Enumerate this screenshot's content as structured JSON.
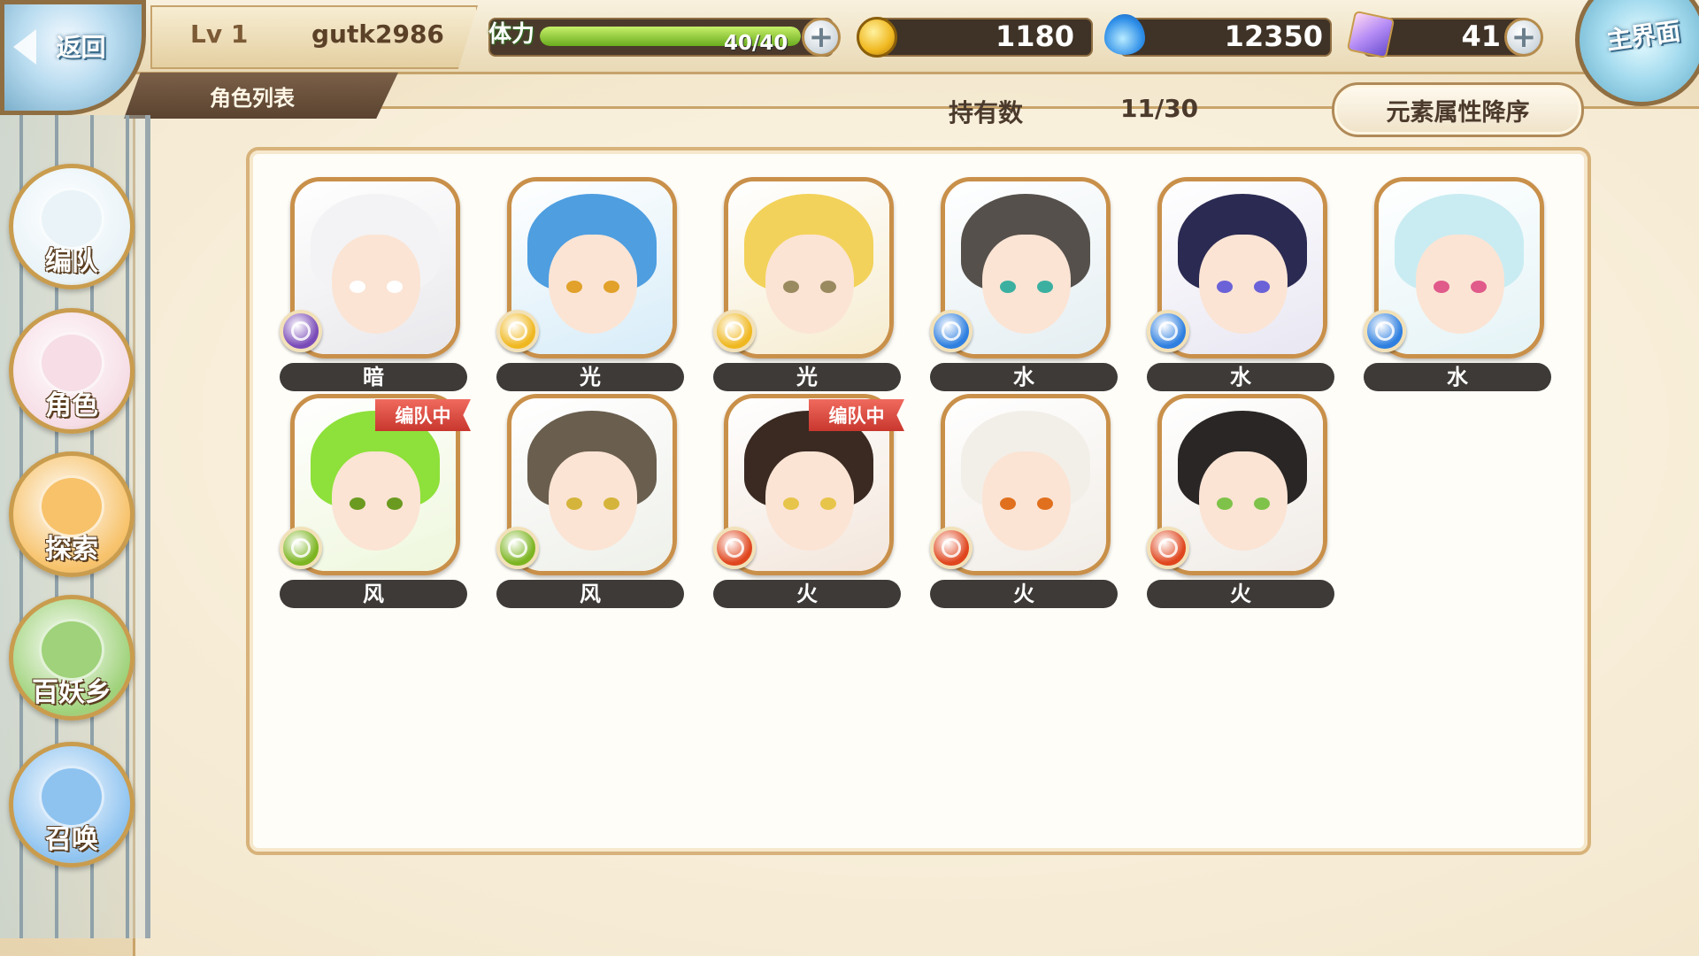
{
  "header": {
    "back_label": "返回",
    "level": "Lv 1",
    "username": "gutk2986",
    "section_title": "角色列表",
    "main_menu_label": "主界面"
  },
  "stamina": {
    "label": "体力",
    "value": "40/40",
    "fill_fraction": 1.0
  },
  "currencies": {
    "gold": {
      "icon": "gold-coin-icon",
      "value": "1180"
    },
    "soul": {
      "icon": "blue-flame-icon",
      "value": "12350"
    },
    "gem": {
      "icon": "crystal-gem-icon",
      "value": "41"
    }
  },
  "owned": {
    "label": "持有数",
    "value": "11/30"
  },
  "sort": {
    "label": "元素属性降序"
  },
  "nav": [
    {
      "id": "team",
      "label": "编队",
      "icon": "cat-mascot-icon",
      "color": "#e9f3f8"
    },
    {
      "id": "character",
      "label": "角色",
      "icon": "character-portrait-icon",
      "color": "#f6dde6"
    },
    {
      "id": "explore",
      "label": "探索",
      "icon": "compass-icon",
      "color": "#f7c26a"
    },
    {
      "id": "village",
      "label": "百妖乡",
      "icon": "village-tent-icon",
      "color": "#9fd27a"
    },
    {
      "id": "summon",
      "label": "召唤",
      "icon": "swirl-portal-icon",
      "color": "#8ec3f0"
    }
  ],
  "badge_label": "编队中",
  "characters": [
    {
      "element": "暗",
      "elem_color": "#7a4bb8",
      "bg": "#e8e8ec",
      "hair": "#f3f3f5",
      "eye": "#ffffff",
      "in_team": false
    },
    {
      "element": "光",
      "elem_color": "#f0b820",
      "bg": "#d7ecf8",
      "hair": "#4e9ee0",
      "eye": "#e1a12a",
      "in_team": false
    },
    {
      "element": "光",
      "elem_color": "#f0b820",
      "bg": "#f6ecd0",
      "hair": "#f2d25a",
      "eye": "#9a8a60",
      "in_team": false
    },
    {
      "element": "水",
      "elem_color": "#2e7fe0",
      "bg": "#e4eef2",
      "hair": "#55504b",
      "eye": "#3bb0a0",
      "in_team": false
    },
    {
      "element": "水",
      "elem_color": "#2e7fe0",
      "bg": "#e8e6f2",
      "hair": "#2b2a52",
      "eye": "#6b62d8",
      "in_team": false
    },
    {
      "element": "水",
      "elem_color": "#2e7fe0",
      "bg": "#e4f3f6",
      "hair": "#c9ecf2",
      "eye": "#e05a8a",
      "in_team": false
    },
    {
      "element": "风",
      "elem_color": "#7cb521",
      "bg": "#eef7dc",
      "hair": "#8ee03a",
      "eye": "#6b9a20",
      "in_team": true
    },
    {
      "element": "风",
      "elem_color": "#7cb521",
      "bg": "#eef0ea",
      "hair": "#6a5e4e",
      "eye": "#d4b43a",
      "in_team": false
    },
    {
      "element": "火",
      "elem_color": "#e0461e",
      "bg": "#f3e6dc",
      "hair": "#3a2a22",
      "eye": "#e7c44a",
      "in_team": true
    },
    {
      "element": "火",
      "elem_color": "#e0461e",
      "bg": "#f1ece6",
      "hair": "#f2efe9",
      "eye": "#e0701e",
      "in_team": false
    },
    {
      "element": "火",
      "elem_color": "#e0461e",
      "bg": "#f0ebe6",
      "hair": "#2a2626",
      "eye": "#7fc24a",
      "in_team": false
    }
  ]
}
